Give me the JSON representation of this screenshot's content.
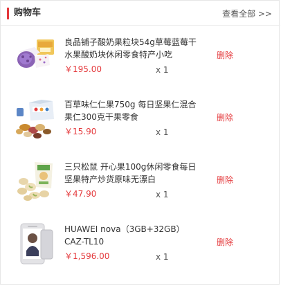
{
  "header": {
    "title": "购物车",
    "view_all": "查看全部 >>"
  },
  "colors": {
    "accent": "#e4393c",
    "text": "#333333"
  },
  "cart": {
    "items": [
      {
        "name": "良品铺子酸奶果粒块54g草莓蓝莓干水果酸奶块休闲零食特产小吃",
        "price": "￥195.00",
        "qty": "x 1",
        "delete": "删除",
        "image": "yogurt-fruit-snack"
      },
      {
        "name": "百草味仁仁果750g 每日坚果仁混合果仁300克干果零食",
        "price": "￥15.90",
        "qty": "x 1",
        "delete": "删除",
        "image": "mixed-nuts-gift-box"
      },
      {
        "name": "三只松鼠 开心果100g休闲零食每日坚果特产炒货原味无漂白",
        "price": "￥47.90",
        "qty": "x 1",
        "delete": "删除",
        "image": "pistachio-bag"
      },
      {
        "name": "HUAWEI nova（3GB+32GB）CAZ-TL10",
        "price": "￥1,596.00",
        "qty": "x 1",
        "delete": "删除",
        "image": "huawei-nova-phone"
      }
    ]
  }
}
